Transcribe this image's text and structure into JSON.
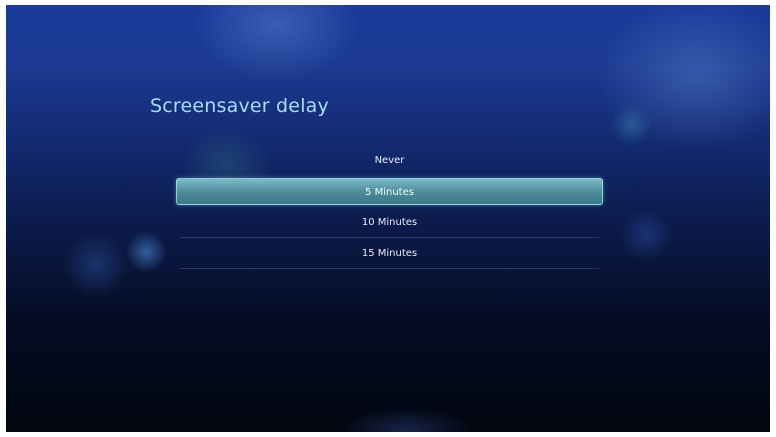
{
  "screen": {
    "title": "Screensaver delay"
  },
  "menu": {
    "items": [
      {
        "label": "Never"
      },
      {
        "label": "5 Minutes"
      },
      {
        "label": "10 Minutes"
      },
      {
        "label": "15 Minutes"
      }
    ],
    "selected_label": "5 Minutes"
  },
  "colors": {
    "title": "#a9dcf6",
    "highlight": "#5f9dac",
    "text": "#e8eef8"
  }
}
